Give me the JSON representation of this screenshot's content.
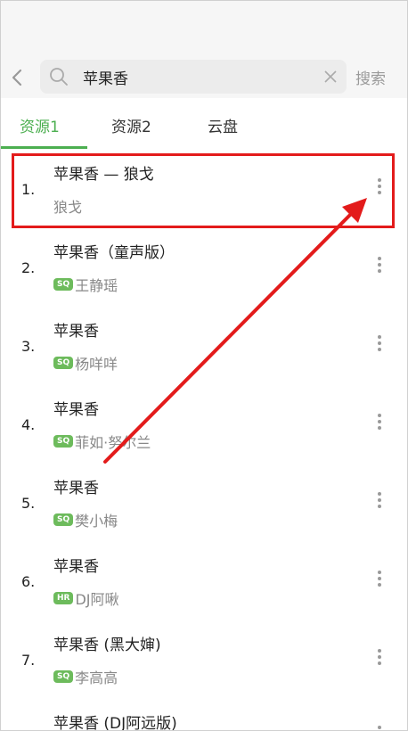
{
  "header": {
    "back_icon": "chevron-left-icon",
    "search_value": "苹果香",
    "search_button": "搜索"
  },
  "tabs": [
    {
      "label": "资源1",
      "active": true
    },
    {
      "label": "资源2",
      "active": false
    },
    {
      "label": "云盘",
      "active": false
    }
  ],
  "results": [
    {
      "num": "1.",
      "title": "苹果香 — 狼戈",
      "artist": "狼戈",
      "badge": ""
    },
    {
      "num": "2.",
      "title": "苹果香（童声版）",
      "artist": "王静瑶",
      "badge": "SQ"
    },
    {
      "num": "3.",
      "title": "苹果香",
      "artist": "杨咩咩",
      "badge": "SQ"
    },
    {
      "num": "4.",
      "title": "苹果香",
      "artist": "菲如·努尔兰",
      "badge": "SQ"
    },
    {
      "num": "5.",
      "title": "苹果香",
      "artist": "樊小梅",
      "badge": "SQ"
    },
    {
      "num": "6.",
      "title": "苹果香",
      "artist": "DJ阿啾",
      "badge": "HR"
    },
    {
      "num": "7.",
      "title": "苹果香 (黑大婶)",
      "artist": "李高高",
      "badge": "SQ"
    },
    {
      "num": "",
      "title": "苹果香 (DJ阿远版)",
      "artist": "",
      "badge": ""
    }
  ],
  "colors": {
    "accent": "#4caf50",
    "annotation": "#e31b1b",
    "badge": "#6dbb5c"
  }
}
